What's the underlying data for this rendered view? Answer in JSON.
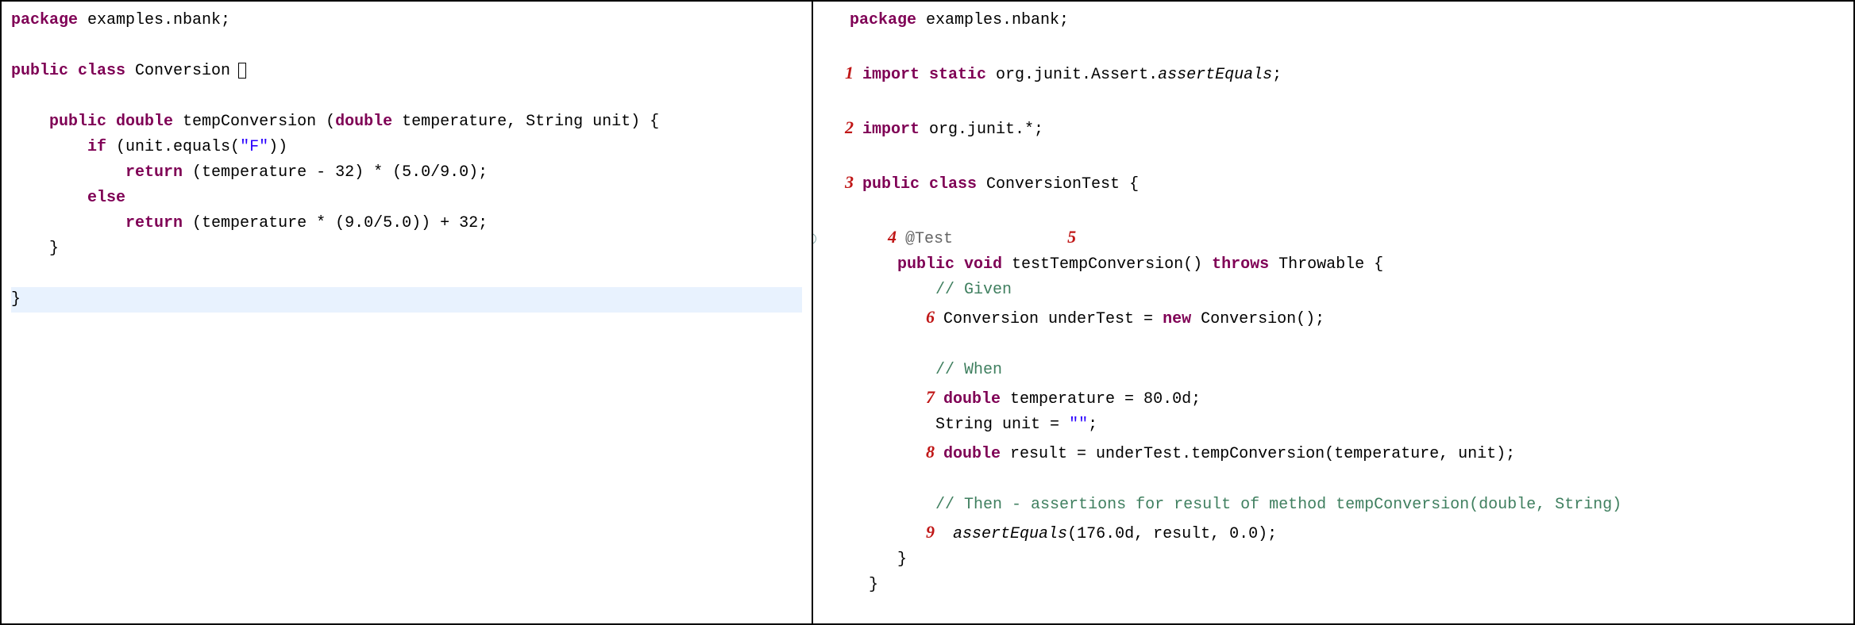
{
  "left": {
    "l1_pkg_kw": "package",
    "l1_pkg": " examples.nbank;",
    "l2_pub": "public class",
    "l2_cls": " Conversion ",
    "l3_sig_a": "public double",
    "l3_sig_b": " tempConversion (",
    "l3_sig_c": "double",
    "l3_sig_d": " temperature, String unit) {",
    "l4_if": "if",
    "l4_cond": " (unit.equals(",
    "l4_str": "\"F\"",
    "l4_close": "))",
    "l5_ret": "return",
    "l5_expr": " (temperature - 32) * (5.0/9.0);",
    "l6_else": "else",
    "l7_ret": "return",
    "l7_expr": " (temperature * (9.0/5.0)) + 32;",
    "l8_close": "}",
    "l9_close": "}"
  },
  "right": {
    "r1_pkg_kw": "package",
    "r1_pkg": " examples.nbank;",
    "m1": "1",
    "r2_imp": "import static",
    "r2_body": " org.junit.Assert.",
    "r2_ae": "assertEquals",
    "r2_semi": ";",
    "m2": "2",
    "r3_imp": "import",
    "r3_body": " org.junit.*;",
    "m3": "3",
    "r4_pub": "public class",
    "r4_cls": " ConversionTest {",
    "m4": "4",
    "r5_ann": "@Test",
    "m5": "5",
    "r6_a": "public void",
    "r6_b": " testTempConversion() ",
    "r6_c": "throws",
    "r6_d": " Throwable {",
    "r7_c": "// Given",
    "m6": "6",
    "r8_a": "Conversion underTest = ",
    "r8_b": "new",
    "r8_c": " Conversion();",
    "r9_c": "// When",
    "m7": "7",
    "r10_a": "double",
    "r10_b": " temperature = 80.0d;",
    "r11": "String unit = ",
    "r11_str": "\"\"",
    "r11_semi": ";",
    "m8": "8",
    "r12_a": "double",
    "r12_b": " result = underTest.tempConversion(temperature, unit);",
    "r13_c": "// Then - assertions for result of method tempConversion(double, String)",
    "m9": "9",
    "r14_a": "assertEquals",
    "r14_b": "(176.0d, result, 0.0);",
    "r15": "}",
    "r16": "}"
  }
}
